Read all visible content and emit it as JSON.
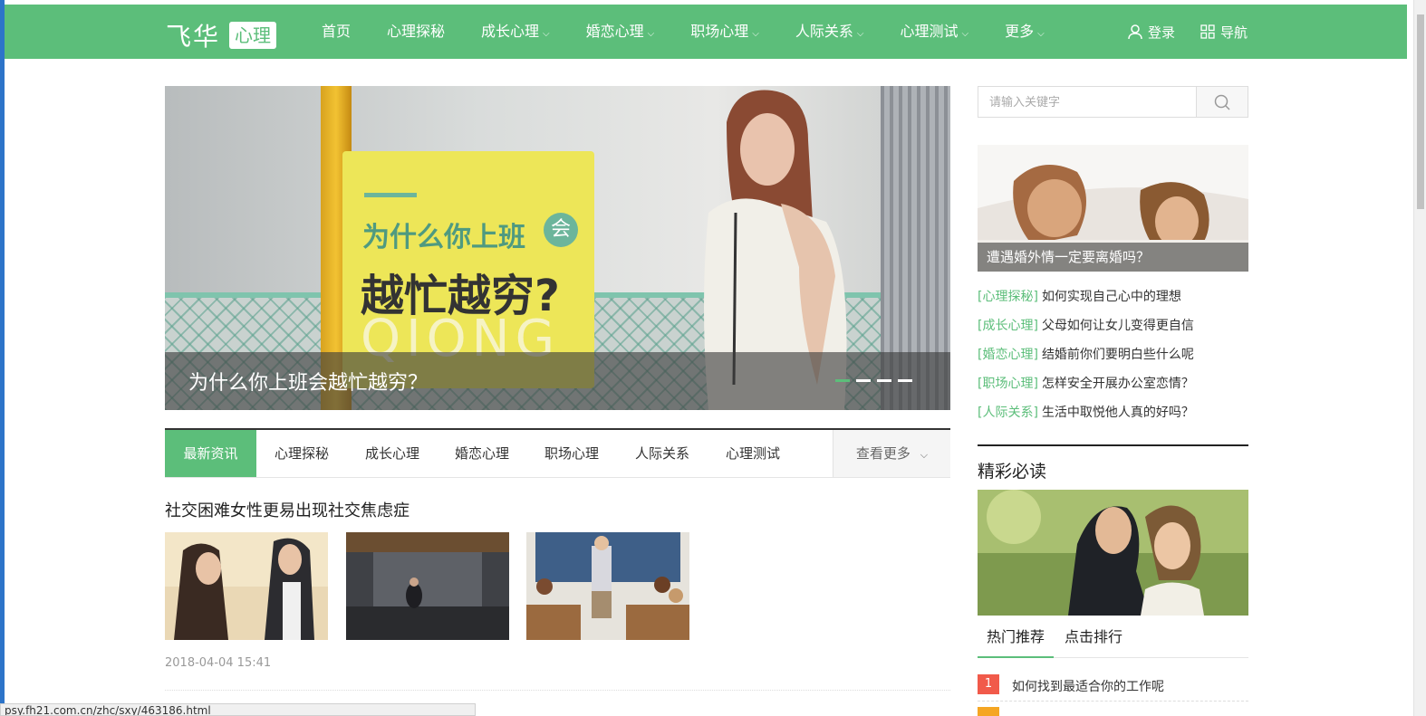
{
  "colors": {
    "brand_green": "#5cbe7a",
    "rank_red": "#f15a4a",
    "rank_orange": "#f5a623"
  },
  "header": {
    "logo_main": "飞华",
    "logo_sub": "心理",
    "nav": [
      {
        "label": "首页",
        "has_caret": false
      },
      {
        "label": "心理探秘",
        "has_caret": false
      },
      {
        "label": "成长心理",
        "has_caret": true
      },
      {
        "label": "婚恋心理",
        "has_caret": true
      },
      {
        "label": "职场心理",
        "has_caret": true
      },
      {
        "label": "人际关系",
        "has_caret": true
      },
      {
        "label": "心理测试",
        "has_caret": true
      },
      {
        "label": "更多",
        "has_caret": true
      }
    ],
    "login_label": "登录",
    "navigation_label": "导航",
    "caret_glyph": "⌵"
  },
  "banner": {
    "card_line1": "为什么你上班",
    "card_circle": "会",
    "card_line2": "越忙越穷?",
    "card_line3": "QIONG",
    "caption": "为什么你上班会越忙越穷？",
    "slide_count": 4,
    "active_slide": 1
  },
  "tabs": {
    "items": [
      "最新资讯",
      "心理探秘",
      "成长心理",
      "婚恋心理",
      "职场心理",
      "人际关系",
      "心理测试"
    ],
    "active_index": 0,
    "more_label": "查看更多"
  },
  "article": {
    "title": "社交困难女性更易出现社交焦虑症",
    "date": "2018-04-04 15:41"
  },
  "status_url": "psy.fh21.com.cn/zhc/sxy/463186.html",
  "sidebar": {
    "search_placeholder": "请输入关键字",
    "feature_caption": "遭遇婚外情一定要离婚吗？",
    "list": [
      {
        "tag": "[心理探秘]",
        "text": "如何实现自己心中的理想"
      },
      {
        "tag": "[成长心理]",
        "text": "父母如何让女儿变得更自信"
      },
      {
        "tag": "[婚恋心理]",
        "text": "结婚前你们要明白些什么呢"
      },
      {
        "tag": "[职场心理]",
        "text": "怎样安全开展办公室恋情？"
      },
      {
        "tag": "[人际关系]",
        "text": "生活中取悦他人真的好吗？"
      }
    ],
    "heading": "精彩必读",
    "tab_hot": "热门推荐",
    "tab_rank": "点击排行",
    "ranking": [
      {
        "num": "1",
        "text": "如何找到最适合你的工作呢"
      }
    ]
  }
}
